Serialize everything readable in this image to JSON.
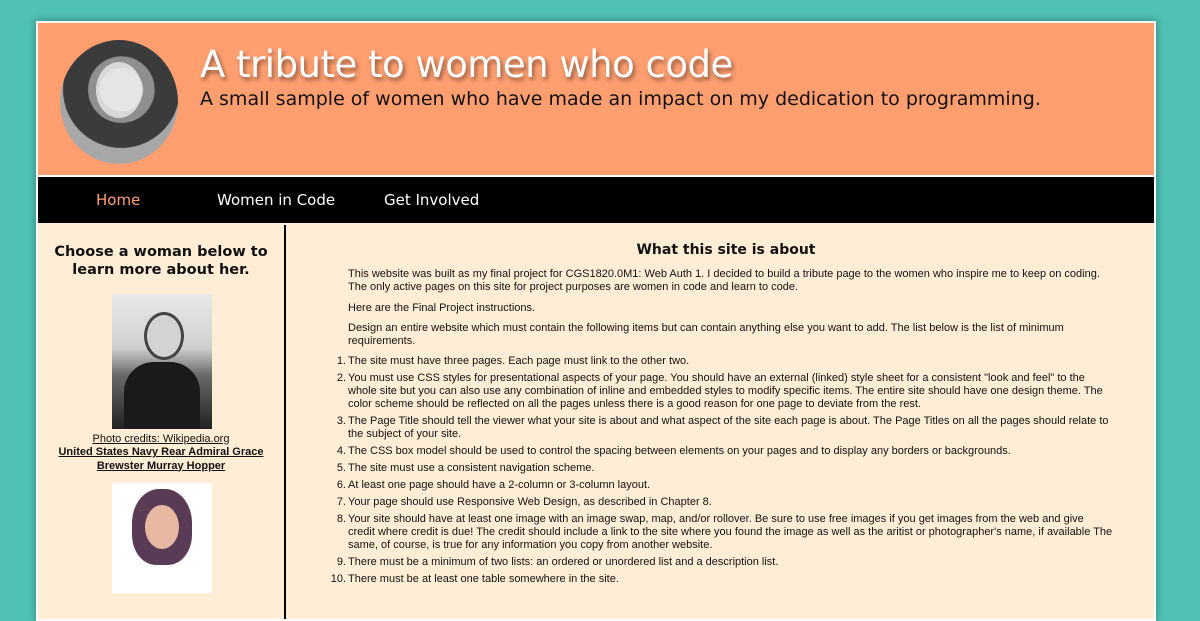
{
  "header": {
    "title": "A tribute to women who code",
    "subtitle": "A small sample of women who have made an impact on my dedication to programming."
  },
  "nav": {
    "items": [
      {
        "label": "Home",
        "active": true
      },
      {
        "label": "Women in Code",
        "active": false
      },
      {
        "label": "Get Involved",
        "active": false
      }
    ]
  },
  "sidebar": {
    "heading": "Choose a woman below to learn more about her.",
    "profiles": [
      {
        "credit": "Photo credits: Wikipedia.org",
        "name": "United States Navy Rear Admiral Grace Brewster Murray Hopper"
      }
    ]
  },
  "main": {
    "heading": "What this site is about",
    "intro": "This website was built as my final project for CGS1820.0M1: Web Auth 1. I decided to build a tribute page to the women who inspire me to keep on coding. The only active pages on this site for project purposes are women in code and learn to code.",
    "instructions_label": "Here are the Final Project instructions.",
    "design_text": "Design an entire website which must contain the following items but can contain anything else you want to add. The list below is the list of minimum requirements.",
    "requirements": [
      "The site must have three pages. Each page must link to the other two.",
      "You must use CSS styles for presentational aspects of your page. You should have an external (linked) style sheet for a consistent \"look and feel\" to the whole site but you can also use any combination of inline and embedded styles to modify specific items. The entire site should have one design theme. The color scheme should be reflected on all the pages unless there is a good reason for one page to deviate from the rest.",
      "The Page Title should tell the viewer what your site is about and what aspect of the site each page is about. The Page Titles on all the pages should relate to the subject of your site.",
      "The CSS box model should be used to control the spacing between elements on your pages and to display any borders or backgrounds.",
      "The site must use a consistent navigation scheme.",
      "At least one page should have a 2-column or 3-column layout.",
      "Your page should use Responsive Web Design, as described in Chapter 8.",
      "Your site should have at least one image with an image swap, map, and/or rollover. Be sure to use free images if you get images from the web and give credit where credit is due! The credit should include a link to the site where you found the image as well as the aritist or photographer's name, if available The same, of course, is true for any information you copy from another website.",
      "There must be a minimum of two lists: an ordered or unordered list and a description list.",
      "There must be at least one table somewhere in the site."
    ]
  },
  "colors": {
    "background": "#4fc1b4",
    "header": "#ff9f70",
    "content": "#ffeed5",
    "nav": "#000000",
    "nav_active": "#ff9f70"
  }
}
